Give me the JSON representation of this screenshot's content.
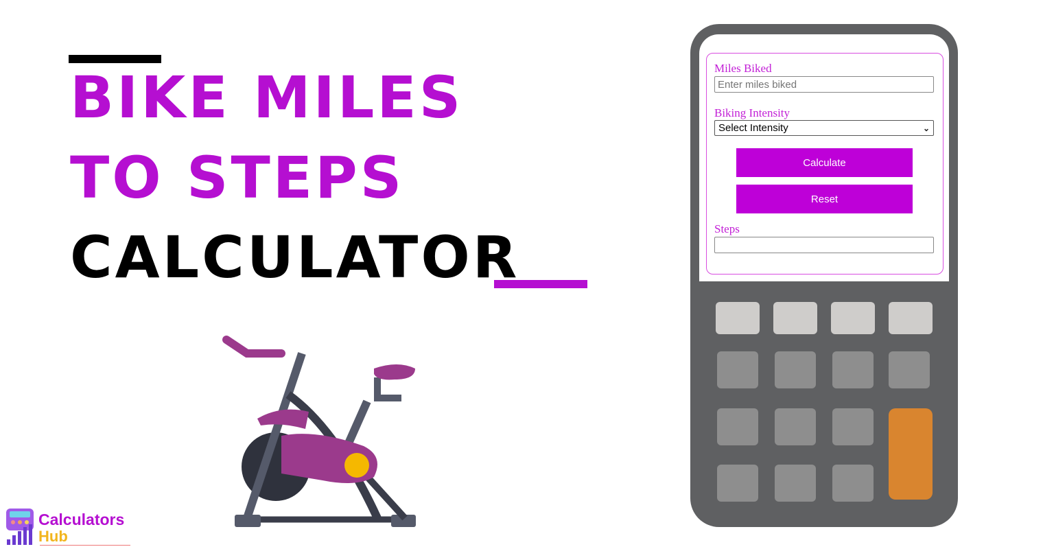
{
  "title": {
    "line1": "Bike Miles",
    "line2": "to Steps",
    "line3": "Calculator"
  },
  "colors": {
    "accent": "#b50fd1",
    "button": "#be00d8",
    "calculator_body": "#5f6062",
    "key_light": "#cfcdcb",
    "key_gray": "#8e8e8e",
    "key_orange": "#d9852f"
  },
  "form": {
    "miles_label": "Miles Biked",
    "miles_placeholder": "Enter miles biked",
    "intensity_label": "Biking Intensity",
    "intensity_selected": "Select Intensity",
    "calculate_label": "Calculate",
    "reset_label": "Reset",
    "steps_label": "Steps",
    "steps_value": ""
  },
  "logo": {
    "line1": "Calculators",
    "line2": "Hub"
  }
}
